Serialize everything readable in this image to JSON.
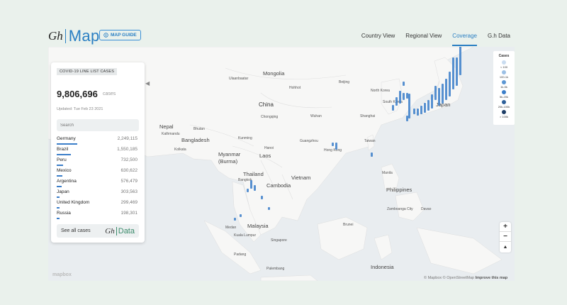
{
  "header": {
    "logo_gh": "Gh",
    "logo_map": "Map",
    "map_guide": "MAP GUIDE",
    "nav": [
      "Country View",
      "Regional View",
      "Coverage",
      "G.h Data"
    ],
    "active_tab": "Coverage"
  },
  "panel": {
    "title": "COVID-19 LINE LIST CASES",
    "total": "9,806,696",
    "total_unit": "cases",
    "updated": "Updated: Tue Feb 23 2021",
    "search_placeholder": "Search",
    "rows": [
      {
        "country": "Germany",
        "value": "2,249,115",
        "share": 0.26
      },
      {
        "country": "Brazil",
        "value": "1,550,185",
        "share": 0.18
      },
      {
        "country": "Peru",
        "value": "732,500",
        "share": 0.08
      },
      {
        "country": "Mexico",
        "value": "630,622",
        "share": 0.07
      },
      {
        "country": "Argentina",
        "value": "576,479",
        "share": 0.066
      },
      {
        "country": "Japan",
        "value": "303,563",
        "share": 0.035
      },
      {
        "country": "United Kingdom",
        "value": "299,469",
        "share": 0.034
      },
      {
        "country": "Russia",
        "value": "198,301",
        "share": 0.023
      }
    ],
    "see_all": "See all cases",
    "data_logo": "Data"
  },
  "legend": {
    "title": "Cases",
    "items": [
      {
        "label": "< 100",
        "color": "#c9dcf0"
      },
      {
        "label": "100-1k",
        "color": "#9cc0e5"
      },
      {
        "label": "1k-5k",
        "color": "#5d97d3"
      },
      {
        "label": "5k-20k",
        "color": "#3b7ec9"
      },
      {
        "label": "20k-100k",
        "color": "#2d5f99"
      },
      {
        "label": "> 100k",
        "color": "#1d3d66"
      }
    ]
  },
  "map_labels": {
    "countries": [
      "Mongolia",
      "China",
      "Nepal",
      "Bhutan",
      "Bangladesh",
      "Myanmar",
      "(Burma)",
      "Laos",
      "Thailand",
      "Vietnam",
      "Cambodia",
      "Philippines",
      "Malaysia",
      "Singapore",
      "Brunei",
      "Indonesia",
      "Taiwan",
      "Hong Kong",
      "North Korea",
      "South Korea",
      "Japan"
    ],
    "cities": [
      "Ulaanbaatar",
      "Hohhot",
      "Beijing",
      "Shanghai",
      "Wuhan",
      "Chongqing",
      "Kunming",
      "Guangzhou",
      "Hanoi",
      "Bangkok",
      "Manila",
      "Kathmandu",
      "Kolkata",
      "Kuala Lumpur",
      "Medan",
      "Padang",
      "Palembang",
      "Zamboanga City",
      "Davao"
    ]
  },
  "zoom": {
    "in": "+",
    "out": "−",
    "north": "▲"
  },
  "attribution": {
    "text": "© Mapbox © OpenStreetMap",
    "improve": "Improve this map",
    "mapbox": "mapbox"
  }
}
